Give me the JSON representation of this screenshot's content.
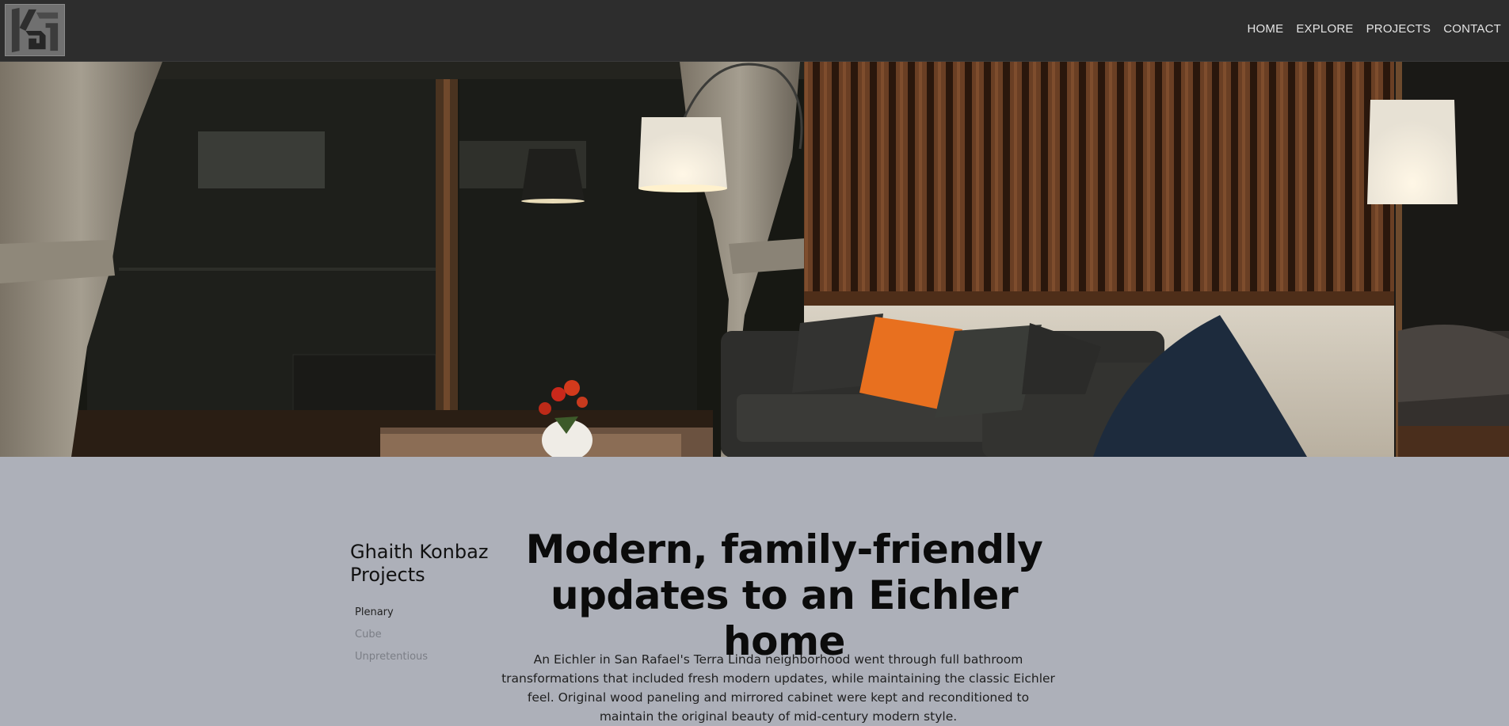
{
  "header": {
    "logo_icon": "kg-monogram-logo-icon",
    "nav": [
      {
        "label": "HOME"
      },
      {
        "label": "EXPLORE"
      },
      {
        "label": "PROJECTS"
      },
      {
        "label": "CONTACT"
      }
    ]
  },
  "hero": {
    "image": "interior-living-room-render"
  },
  "sidebar": {
    "title": "Ghaith Konbaz Projects",
    "items": [
      {
        "label": "Plenary",
        "active": true
      },
      {
        "label": "Cube",
        "active": false
      },
      {
        "label": "Unpretentious",
        "active": false
      }
    ]
  },
  "article": {
    "headline": "Modern, family-friendly updates to an Eichler home",
    "body": "An Eichler in San Rafael's Terra Linda neighborhood went through full bathroom transformations that included fresh modern updates, while maintaining the classic Eichler feel. Original wood paneling and mirrored cabinet were kept and reconditioned to maintain the original beauty of mid-century modern style."
  },
  "colors": {
    "topbar": "#2d2d2d",
    "content_bg": "#adb0b9",
    "nav_text": "#e4e4e4"
  }
}
